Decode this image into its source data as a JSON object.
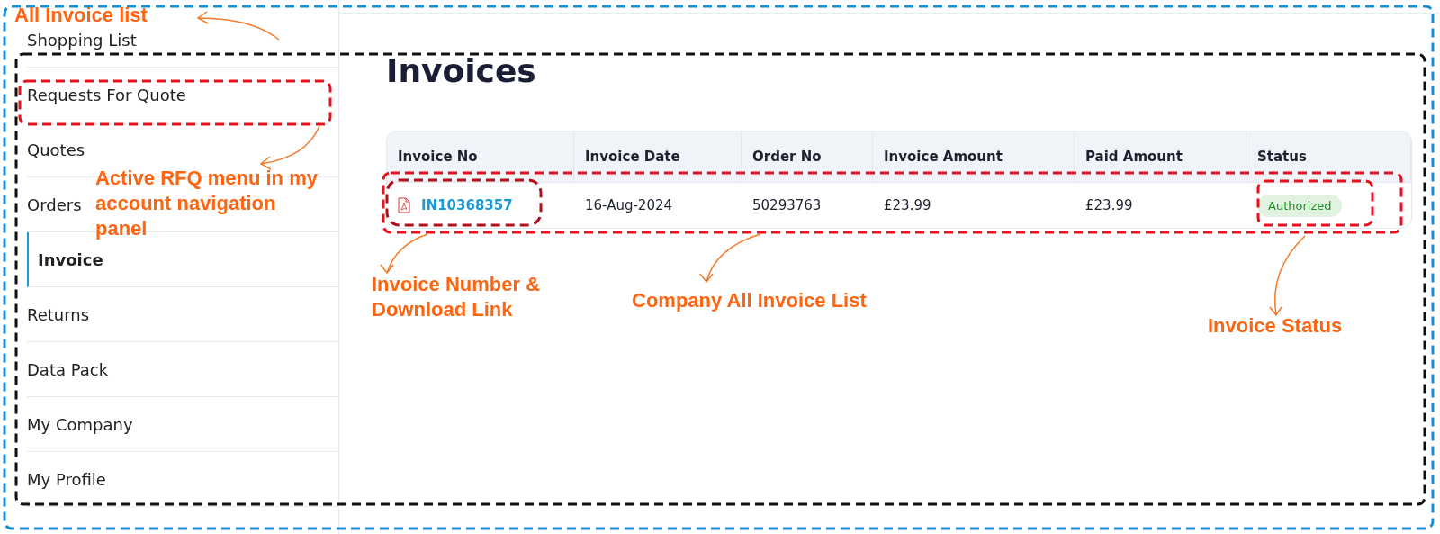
{
  "sidebar": {
    "items": [
      {
        "label": "Shopping List",
        "selected": false
      },
      {
        "label": "Requests For Quote",
        "selected": false
      },
      {
        "label": "Quotes",
        "selected": false
      },
      {
        "label": "Orders",
        "selected": false
      },
      {
        "label": "Invoice",
        "selected": true
      },
      {
        "label": "Returns",
        "selected": false
      },
      {
        "label": "Data Pack",
        "selected": false
      },
      {
        "label": "My Company",
        "selected": false
      },
      {
        "label": "My Profile",
        "selected": false
      }
    ]
  },
  "page": {
    "title": "Invoices"
  },
  "table": {
    "columns": [
      "Invoice No",
      "Invoice Date",
      "Order No",
      "Invoice Amount",
      "Paid Amount",
      "Status"
    ],
    "rows": [
      {
        "invoice_no": "IN10368357",
        "invoice_date": "16-Aug-2024",
        "order_no": "50293763",
        "invoice_amount": "£23.99",
        "paid_amount": "£23.99",
        "status": "Authorized"
      }
    ]
  },
  "annotations": {
    "boxes": [
      {
        "color": "#1a8fd0"
      },
      {
        "color": "#111111"
      },
      {
        "color": "#e8121e"
      },
      {
        "color": "#e8121e"
      },
      {
        "color": "#b0101c"
      },
      {
        "color": "#e8121e"
      }
    ],
    "labels": [
      {
        "text": "All Invoice list"
      },
      {
        "text": "Active RFQ menu in my account navigation panel"
      },
      {
        "text": "Invoice Number & Download Link"
      },
      {
        "text": "Company All Invoice List"
      },
      {
        "text": "Invoice Status"
      }
    ]
  }
}
